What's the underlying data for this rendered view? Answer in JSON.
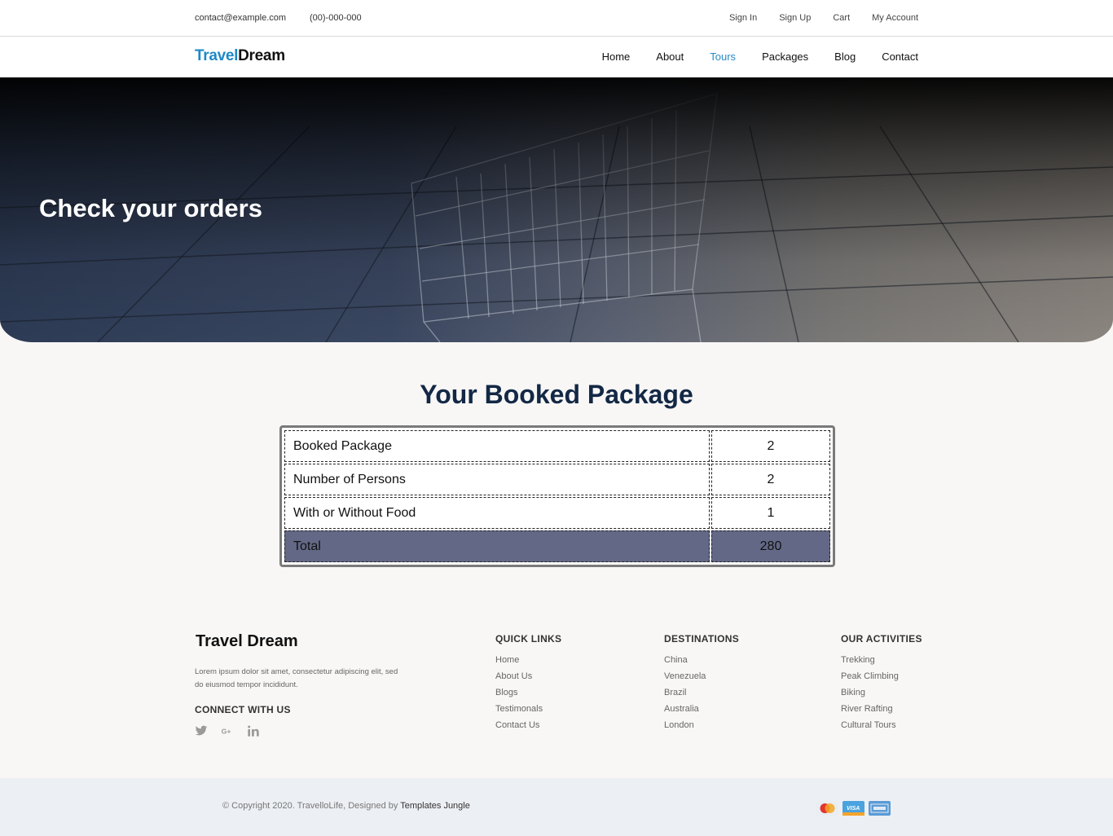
{
  "topbar": {
    "email": "contact@example.com",
    "phone": "(00)-000-000",
    "links": [
      "Sign In",
      "Sign Up",
      "Cart",
      "My Account"
    ]
  },
  "brand": {
    "part1": "Travel",
    "part2": "Dream"
  },
  "nav": {
    "items": [
      "Home",
      "About",
      "Tours",
      "Packages",
      "Blog",
      "Contact"
    ],
    "active": "Tours"
  },
  "hero": {
    "title": "Check your orders"
  },
  "order": {
    "title": "Your Booked Package",
    "rows": [
      {
        "label": "Booked Package",
        "value": "2"
      },
      {
        "label": "Number of Persons",
        "value": "2"
      },
      {
        "label": "With or Without Food",
        "value": "1"
      }
    ],
    "total": {
      "label": "Total",
      "value": "280"
    },
    "total_color": "#636886"
  },
  "footer": {
    "brand": "Travel Dream",
    "description": "Lorem ipsum dolor sit amet, consectetur adipiscing elit, sed do eiusmod tempor incididunt.",
    "connect_heading": "CONNECT WITH US",
    "social_icons": [
      "twitter-icon",
      "google-plus-icon",
      "linkedin-icon"
    ],
    "quick_links": {
      "heading": "QUICK LINKS",
      "items": [
        "Home",
        "About Us",
        "Blogs",
        "Testimonals",
        "Contact Us"
      ]
    },
    "destinations": {
      "heading": "DESTINATIONS",
      "items": [
        "China",
        "Venezuela",
        "Brazil",
        "Australia",
        "London"
      ]
    },
    "activities": {
      "heading": "OUR ACTIVITIES",
      "items": [
        "Trekking",
        "Peak Climbing",
        "Biking",
        "River Rafting",
        "Cultural Tours"
      ]
    }
  },
  "copyright": {
    "text": "© Copyright 2020. TravelloLife, Designed by ",
    "designer": "Templates Jungle",
    "payment_icons": [
      "mastercard-icon",
      "visa-icon",
      "amex-icon"
    ]
  },
  "colors": {
    "accent": "#2b8ac6",
    "heading": "#132845"
  }
}
